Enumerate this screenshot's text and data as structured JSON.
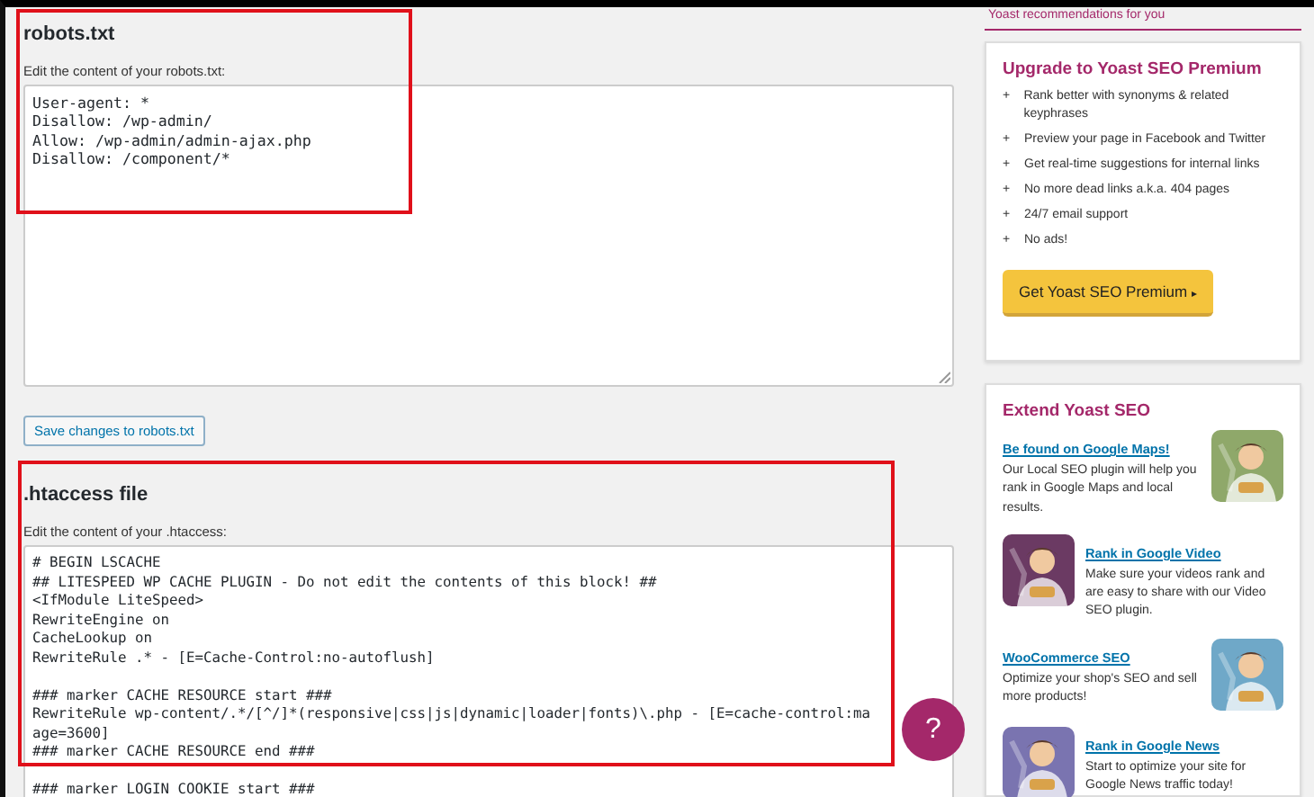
{
  "robots": {
    "title": "robots.txt",
    "label": "Edit the content of your robots.txt:",
    "lines": [
      "User-agent: *",
      "Disallow: /wp-admin/",
      "Allow: /wp-admin/admin-ajax.php",
      "Disallow: /component/*"
    ],
    "button": "Save changes to robots.txt"
  },
  "htaccess": {
    "title": ".htaccess file",
    "label": "Edit the content of your .htaccess:",
    "blocks": [
      [
        "# BEGIN LSCACHE",
        "## LITESPEED WP CACHE PLUGIN - Do not edit the contents of this block! ##",
        "<IfModule LiteSpeed>",
        "RewriteEngine on",
        "CacheLookup on",
        "RewriteRule .* - [E=Cache-Control:no-autoflush]"
      ],
      [
        "### marker CACHE RESOURCE start ###",
        "RewriteRule wp-content/.*/[^/]*(responsive|css|js|dynamic|loader|fonts)\\.php - [E=cache-control:ma",
        "age=3600]",
        "### marker CACHE RESOURCE end ###"
      ],
      [
        "### marker LOGIN COOKIE start ###"
      ]
    ]
  },
  "help_button": "?",
  "sidebar": {
    "recommendations": "Yoast recommendations for you",
    "premium": {
      "title": "Upgrade to Yoast SEO Premium",
      "features": [
        "Rank better with synonyms & related keyphrases",
        "Preview your page in Facebook and Twitter",
        "Get real-time suggestions for internal links",
        "No more dead links a.k.a. 404 pages",
        "24/7 email support",
        "No ads!"
      ],
      "bullet": "+",
      "button": "Get Yoast SEO Premium",
      "button_arrow": "▸"
    },
    "extend": {
      "title": "Extend Yoast SEO",
      "items": [
        {
          "link": "Be found on Google Maps!",
          "text": "Our Local SEO plugin will help you rank in Google Maps and local results.",
          "kind": "image-right",
          "color": "#8fa86a"
        },
        {
          "link": "Rank in Google Video",
          "text": "Make sure your videos rank and are easy to share with our Video SEO plugin.",
          "kind": "image-left",
          "color": "#6b3a63"
        },
        {
          "link": "WooCommerce SEO",
          "text": "Optimize your shop's SEO and sell more products!",
          "kind": "image-right",
          "color": "#6fa8c8"
        },
        {
          "link": "Rank in Google News",
          "text": "Start to optimize your site for Google News traffic today!",
          "kind": "image-left",
          "color": "#7a74b0"
        }
      ]
    }
  }
}
